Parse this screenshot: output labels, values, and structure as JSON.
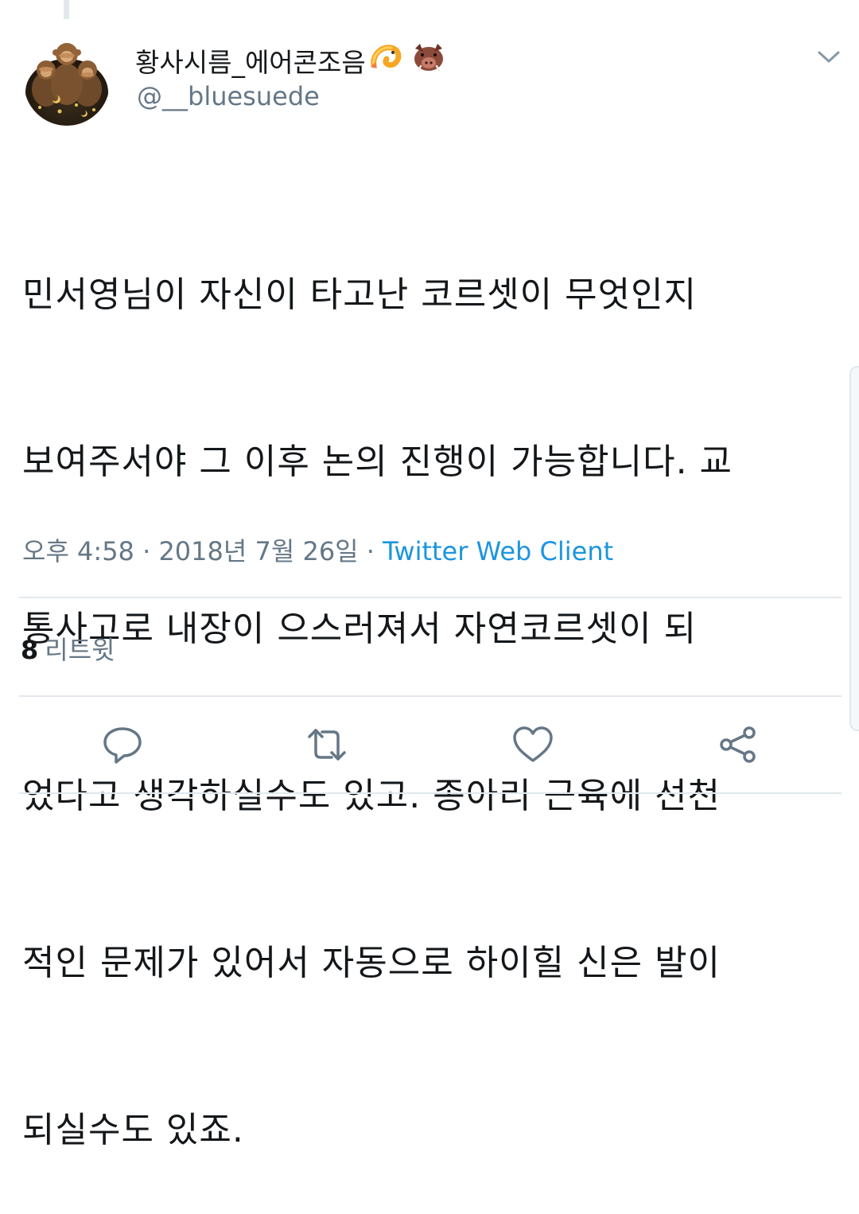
{
  "user": {
    "display_name": "황사시름_에어콘조음",
    "name_emojis": [
      "shrimp-emoji",
      "boar-emoji"
    ],
    "handle": "@__bluesuede",
    "avatar": "three-monkeys-avatar"
  },
  "tweet": {
    "lines": [
      "민서영님이 자신이 타고난 코르셋이 무엇인지",
      "보여주서야 그 이후 논의 진행이 가능합니다. 교",
      "통사고로 내장이 으스러져서 자연코르셋이 되",
      "었다고 생각하실수도 있고. 종아리 근육에 선천",
      "적인 문제가 있어서 자동으로 하이힐 신은 발이",
      "되실수도 있죠."
    ]
  },
  "meta": {
    "time": "오후 4:58",
    "separator": " · ",
    "date": "2018년 7월 26일",
    "client": "Twitter Web Client"
  },
  "stats": {
    "retweet_count": "8",
    "retweet_label": "리트윗"
  },
  "actions": {
    "icons": [
      "reply-icon",
      "retweet-icon",
      "like-icon",
      "share-icon"
    ]
  },
  "colors": {
    "text": "#14171a",
    "secondary": "#657786",
    "link": "#1b95e0",
    "divider": "#e1e8ed"
  }
}
